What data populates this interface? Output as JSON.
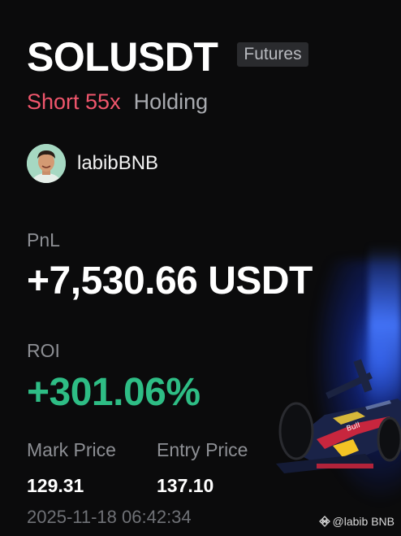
{
  "position": {
    "symbol": "SOLUSDT",
    "market_badge": "Futures",
    "side_leverage": "Short 55x",
    "status": "Holding"
  },
  "user": {
    "name": "labibBNB"
  },
  "pnl": {
    "label": "PnL",
    "value": "+7,530.66 USDT"
  },
  "roi": {
    "label": "ROI",
    "value": "+301.06%"
  },
  "prices": {
    "mark_label": "Mark Price",
    "mark_value": "129.31",
    "entry_label": "Entry Price",
    "entry_value": "137.10"
  },
  "timestamp": "2025-11-18 06:42:34",
  "watermark": "@labib BNB",
  "colors": {
    "background": "#0b0b0c",
    "short": "#f0566c",
    "roi_positive": "#2ebd85",
    "muted": "#8d8f94",
    "badge_bg": "#2a2b2e"
  },
  "icons": {
    "watermark_icon": "binance-logo-icon",
    "avatar": "user-avatar",
    "decoration": "race-car-illustration"
  }
}
